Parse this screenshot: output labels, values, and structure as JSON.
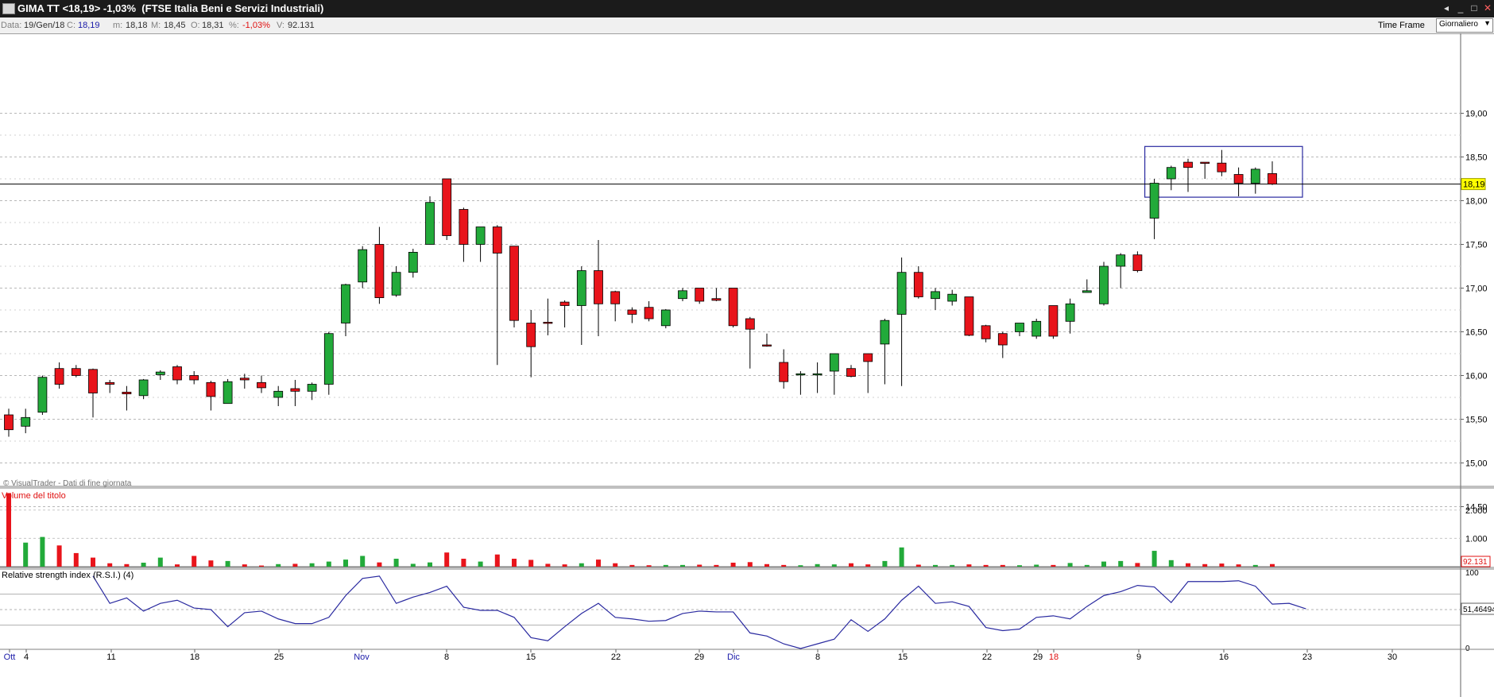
{
  "window": {
    "title": "GIMA TT <18,19> -1,03%  (FTSE Italia Beni e Servizi Industriali)",
    "buttons": [
      "◂",
      "_",
      "□",
      "✕"
    ]
  },
  "infobar": {
    "data_label": "Data:",
    "data_value": "19/Gen/18",
    "close_label": "C:",
    "close_value": "18,19",
    "min_label": "m:",
    "min_value": "18,18",
    "max_label": "M:",
    "max_value": "18,45",
    "open_label": "O:",
    "open_value": "18,31",
    "pct_label": "%:",
    "pct_value": "-1,03%",
    "vol_label": "V:",
    "vol_value": "92.131",
    "timeframe_label": "Time Frame",
    "timeframe_value": "Giornaliero"
  },
  "colors": {
    "up": "#22aa3a",
    "down": "#e8141b",
    "rsi_line": "#2a2aa0",
    "box": "#2a2aa0"
  },
  "chart_data": [
    {
      "type": "candlestick",
      "x_labels": [
        "Ott",
        "4",
        "11",
        "18",
        "25",
        "Nov",
        "8",
        "15",
        "22",
        "29",
        "Dic",
        "8",
        "15",
        "22",
        "29",
        "18",
        "9",
        "16",
        "23",
        "30"
      ],
      "y_ticks": [
        "19,00",
        "18,50",
        "18,00",
        "17,50",
        "17,00",
        "16,50",
        "16,00",
        "15,50",
        "15,00",
        "14,50"
      ],
      "ylim": [
        14.5,
        19.3
      ],
      "last_price": 18.19,
      "last_label": "18,19",
      "watermark": "© VisualTrader - Dati di fine giornata",
      "ohlc": [
        [
          15.55,
          15.62,
          15.3,
          15.38
        ],
        [
          15.42,
          15.62,
          15.34,
          15.52
        ],
        [
          15.58,
          16.0,
          15.55,
          15.98
        ],
        [
          16.08,
          16.15,
          15.85,
          15.9
        ],
        [
          16.08,
          16.12,
          15.98,
          16.0
        ],
        [
          16.07,
          16.08,
          15.52,
          15.8
        ],
        [
          15.92,
          15.95,
          15.8,
          15.9
        ],
        [
          15.81,
          15.88,
          15.6,
          15.79
        ],
        [
          15.77,
          15.96,
          15.73,
          15.95
        ],
        [
          16.01,
          16.06,
          15.95,
          16.04
        ],
        [
          16.1,
          16.12,
          15.9,
          15.95
        ],
        [
          16.0,
          16.05,
          15.9,
          15.95
        ],
        [
          15.92,
          15.94,
          15.6,
          15.76
        ],
        [
          15.68,
          15.96,
          15.68,
          15.93
        ],
        [
          15.97,
          16.02,
          15.85,
          15.95
        ],
        [
          15.92,
          16.0,
          15.8,
          15.86
        ],
        [
          15.75,
          15.88,
          15.65,
          15.82
        ],
        [
          15.85,
          15.95,
          15.65,
          15.82
        ],
        [
          15.82,
          15.92,
          15.72,
          15.9
        ],
        [
          15.9,
          16.5,
          15.78,
          16.48
        ],
        [
          16.6,
          17.05,
          16.45,
          17.04
        ],
        [
          17.07,
          17.48,
          17.0,
          17.44
        ],
        [
          17.5,
          17.7,
          16.82,
          16.89
        ],
        [
          16.92,
          17.25,
          16.9,
          17.18
        ],
        [
          17.18,
          17.45,
          17.12,
          17.41
        ],
        [
          17.5,
          18.05,
          17.5,
          17.98
        ],
        [
          18.25,
          18.25,
          17.55,
          17.6
        ],
        [
          17.9,
          17.92,
          17.3,
          17.5
        ],
        [
          17.5,
          17.7,
          17.3,
          17.7
        ],
        [
          17.7,
          17.72,
          16.12,
          17.4
        ],
        [
          17.48,
          17.48,
          16.55,
          16.63
        ],
        [
          16.6,
          16.75,
          15.98,
          16.33
        ],
        [
          16.61,
          16.88,
          16.46,
          16.6
        ],
        [
          16.84,
          16.86,
          16.55,
          16.8
        ],
        [
          16.8,
          17.25,
          16.35,
          17.2
        ],
        [
          17.2,
          17.55,
          16.45,
          16.82
        ],
        [
          16.96,
          16.97,
          16.62,
          16.82
        ],
        [
          16.75,
          16.78,
          16.6,
          16.7
        ],
        [
          16.78,
          16.85,
          16.62,
          16.65
        ],
        [
          16.57,
          16.76,
          16.54,
          16.75
        ],
        [
          16.88,
          17.0,
          16.85,
          16.97
        ],
        [
          17.0,
          17.0,
          16.82,
          16.85
        ],
        [
          16.88,
          17.0,
          16.85,
          16.86
        ],
        [
          17.0,
          17.0,
          16.55,
          16.57
        ],
        [
          16.65,
          16.67,
          16.08,
          16.53
        ],
        [
          16.35,
          16.48,
          16.33,
          16.34
        ],
        [
          16.15,
          16.3,
          15.85,
          15.93
        ],
        [
          16.02,
          16.05,
          15.78,
          16.02
        ],
        [
          16.01,
          16.15,
          15.8,
          16.02
        ],
        [
          16.05,
          16.25,
          15.78,
          16.25
        ],
        [
          16.08,
          16.12,
          15.98,
          15.99
        ],
        [
          16.25,
          16.25,
          15.8,
          16.16
        ],
        [
          16.36,
          16.65,
          15.9,
          16.63
        ],
        [
          16.7,
          17.35,
          15.88,
          17.18
        ],
        [
          17.18,
          17.25,
          16.88,
          16.9
        ],
        [
          16.88,
          17.0,
          16.75,
          16.96
        ],
        [
          16.85,
          16.98,
          16.8,
          16.93
        ],
        [
          16.9,
          16.9,
          16.45,
          16.46
        ],
        [
          16.57,
          16.58,
          16.38,
          16.42
        ],
        [
          16.48,
          16.5,
          16.2,
          16.35
        ],
        [
          16.5,
          16.6,
          16.45,
          16.6
        ],
        [
          16.45,
          16.65,
          16.42,
          16.62
        ],
        [
          16.8,
          16.8,
          16.42,
          16.45
        ],
        [
          16.62,
          16.88,
          16.48,
          16.82
        ],
        [
          16.95,
          17.1,
          16.95,
          16.97
        ],
        [
          16.82,
          17.3,
          16.8,
          17.25
        ],
        [
          17.25,
          17.4,
          17.0,
          17.38
        ],
        [
          17.38,
          17.42,
          17.18,
          17.2
        ],
        [
          17.8,
          18.25,
          17.56,
          18.2
        ],
        [
          18.25,
          18.4,
          18.12,
          18.38
        ],
        [
          18.44,
          18.48,
          18.1,
          18.38
        ],
        [
          18.44,
          18.44,
          18.25,
          18.43
        ],
        [
          18.43,
          18.58,
          18.28,
          18.33
        ],
        [
          18.3,
          18.38,
          18.05,
          18.2
        ],
        [
          18.2,
          18.38,
          18.08,
          18.36
        ],
        [
          18.31,
          18.45,
          18.18,
          18.19
        ]
      ],
      "highlight_box": {
        "from_index": 68,
        "to_index": 75,
        "y_high": 18.62,
        "y_low": 18.04
      }
    },
    {
      "type": "bar",
      "title": "Volume del titolo",
      "y_ticks": [
        "2.000",
        "1.000"
      ],
      "ylim": [
        0,
        2600
      ],
      "last_label": "92.131",
      "values": [
        2600,
        850,
        1050,
        750,
        480,
        320,
        120,
        90,
        140,
        320,
        80,
        380,
        220,
        200,
        80,
        40,
        90,
        100,
        120,
        180,
        250,
        380,
        150,
        280,
        100,
        150,
        500,
        280,
        180,
        430,
        280,
        240,
        100,
        80,
        120,
        250,
        120,
        60,
        50,
        60,
        60,
        70,
        60,
        140,
        160,
        90,
        60,
        50,
        90,
        80,
        120,
        80,
        200,
        680,
        70,
        60,
        60,
        80,
        60,
        60,
        50,
        70,
        60,
        130,
        60,
        180,
        200,
        130,
        560,
        230,
        120,
        90,
        110,
        80,
        60,
        92
      ]
    },
    {
      "type": "line",
      "title": "Relative strength index (R.S.I.) (4)",
      "ylim": [
        0,
        100
      ],
      "y_ticks": [
        "100",
        "0"
      ],
      "last_label": "51,46494",
      "values": [
        null,
        null,
        null,
        null,
        null,
        93,
        58,
        65,
        48,
        58,
        62,
        52,
        50,
        28,
        46,
        48,
        38,
        32,
        32,
        40,
        68,
        90,
        93,
        58,
        66,
        72,
        80,
        53,
        49,
        49,
        40,
        14,
        10,
        28,
        45,
        58,
        40,
        38,
        35,
        36,
        45,
        48,
        47,
        47,
        20,
        16,
        6,
        0,
        6,
        12,
        37,
        22,
        38,
        62,
        80,
        58,
        60,
        54,
        27,
        23,
        25,
        40,
        42,
        38,
        54,
        68,
        73,
        81,
        79,
        59,
        86,
        86,
        86,
        87,
        80,
        57,
        58,
        51
      ]
    }
  ]
}
